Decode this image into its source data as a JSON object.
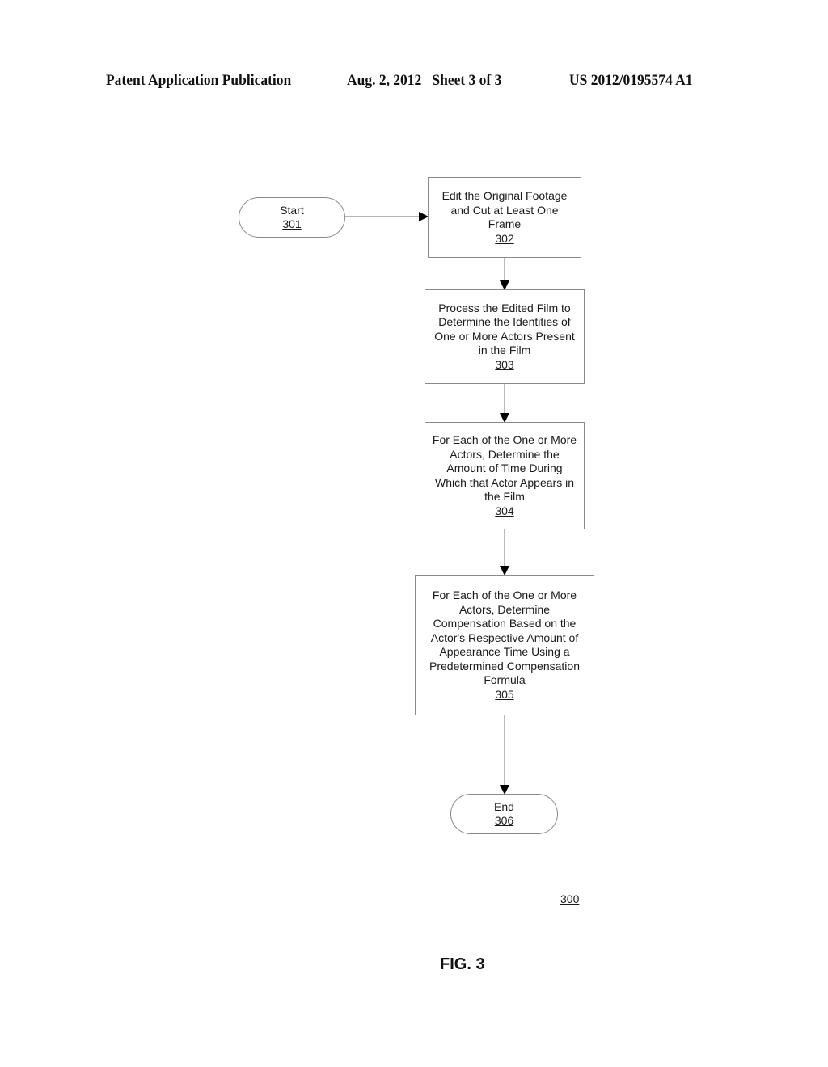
{
  "header": {
    "left": "Patent Application Publication",
    "middle": "Aug. 2, 2012   Sheet 3 of 3",
    "right": "US 2012/0195574 A1"
  },
  "flowchart": {
    "nodes": [
      {
        "id": "301",
        "type": "terminal",
        "label": "Start",
        "ref": "301"
      },
      {
        "id": "302",
        "type": "process",
        "label": "Edit the Original Footage and Cut at Least One Frame",
        "ref": "302"
      },
      {
        "id": "303",
        "type": "process",
        "label": "Process the Edited Film to Determine the Identities of One or More Actors Present in the Film",
        "ref": "303"
      },
      {
        "id": "304",
        "type": "process",
        "label": "For Each of the One or More Actors, Determine the Amount of Time During Which that Actor Appears in the Film",
        "ref": "304"
      },
      {
        "id": "305",
        "type": "process",
        "label": "For Each of the One or More Actors, Determine Compensation Based on the Actor's Respective Amount of Appearance Time Using a Predetermined Compensation Formula",
        "ref": "305"
      },
      {
        "id": "306",
        "type": "terminal",
        "label": "End",
        "ref": "306"
      }
    ],
    "edges": [
      {
        "from": "301",
        "to": "302"
      },
      {
        "from": "302",
        "to": "303"
      },
      {
        "from": "303",
        "to": "304"
      },
      {
        "from": "304",
        "to": "305"
      },
      {
        "from": "305",
        "to": "306"
      }
    ],
    "diagram_ref": "300"
  },
  "figure_label": "FIG. 3"
}
